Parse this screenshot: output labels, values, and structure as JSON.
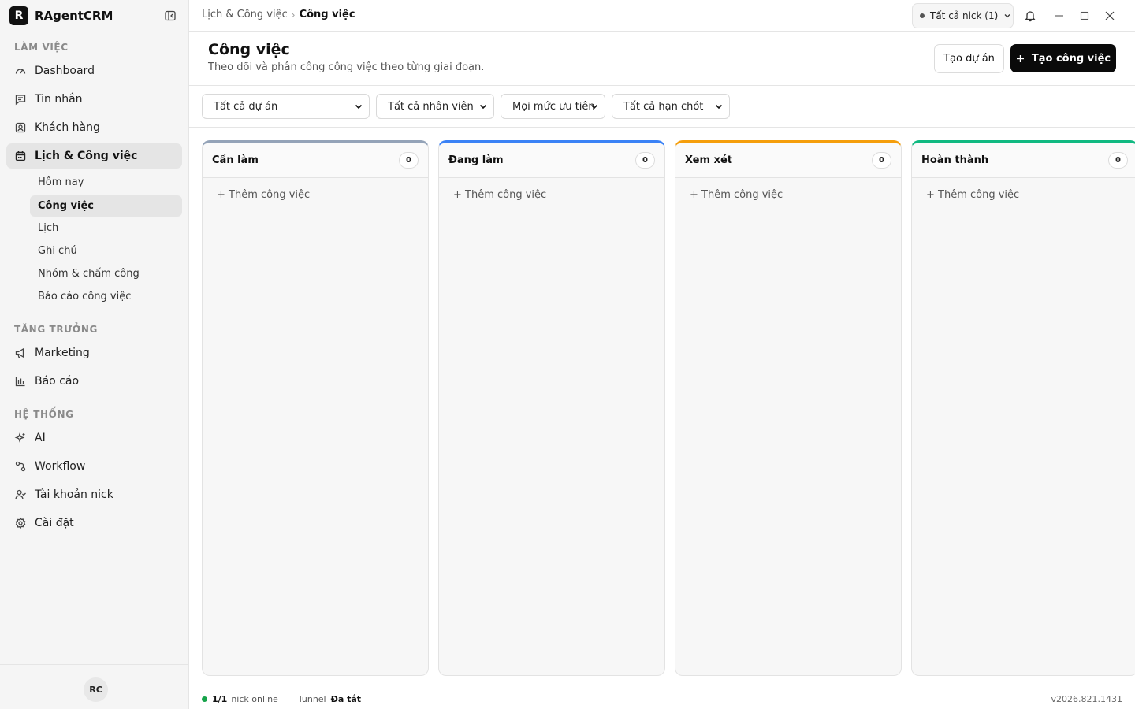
{
  "app": {
    "logo_letter": "R",
    "name": "RAgentCRM"
  },
  "sidebar": {
    "sections": {
      "work": "LÀM VIỆC",
      "growth": "TĂNG TRƯỞNG",
      "system": "HỆ THỐNG"
    },
    "items": {
      "dashboard": "Dashboard",
      "messages": "Tin nhắn",
      "customers": "Khách hàng",
      "schedule": "Lịch & Công việc",
      "marketing": "Marketing",
      "reports": "Báo cáo",
      "ai": "AI",
      "workflow": "Workflow",
      "accounts": "Tài khoản nick",
      "settings": "Cài đặt"
    },
    "sub_items": {
      "today": "Hôm nay",
      "tasks": "Công việc",
      "calendar": "Lịch",
      "notes": "Ghi chú",
      "teams": "Nhóm & chấm công",
      "task_reports": "Báo cáo công việc"
    },
    "active_item": "schedule",
    "active_sub_item": "tasks",
    "avatar_initials": "RC"
  },
  "topbar": {
    "breadcrumb_parent": "Lịch & Công việc",
    "breadcrumb_current": "Công việc",
    "nick_select": "Tất cả nick (1)"
  },
  "header": {
    "title": "Công việc",
    "subtitle": "Theo dõi và phân công công việc theo từng giai đoạn.",
    "create_project_label": "Tạo dự án",
    "create_task_label": "Tạo công việc"
  },
  "filters": {
    "project": "Tất cả dự án",
    "staff": "Tất cả nhân viên",
    "priority": "Mọi mức ưu tiên",
    "deadline": "Tất cả hạn chót"
  },
  "columns": [
    {
      "title": "Cần làm",
      "count": "0",
      "add_label": "+ Thêm công việc",
      "accent": "#94a3b8"
    },
    {
      "title": "Đang làm",
      "count": "0",
      "add_label": "+ Thêm công việc",
      "accent": "#3b82f6"
    },
    {
      "title": "Xem xét",
      "count": "0",
      "add_label": "+ Thêm công việc",
      "accent": "#f59e0b"
    },
    {
      "title": "Hoàn thành",
      "count": "0",
      "add_label": "+ Thêm công việc",
      "accent": "#10b981"
    }
  ],
  "status": {
    "online_count": "1/1",
    "online_label": "nick online",
    "tunnel_label": "Tunnel",
    "tunnel_value": "Đã tắt",
    "version": "v2026.821.1431",
    "online_color": "#16a34a"
  },
  "icons": {
    "collapse": "sidebar-collapse-icon",
    "dashboard": "gauge-icon",
    "messages": "message-square-icon",
    "customers": "contact-icon",
    "schedule": "calendar-icon",
    "marketing": "megaphone-icon",
    "reports": "bar-chart-icon",
    "ai": "sparkles-icon",
    "workflow": "workflow-icon",
    "accounts": "user-check-icon",
    "settings": "gear-icon",
    "bell": "bell-icon",
    "minimize": "minimize-icon",
    "maximize": "maximize-icon",
    "close": "close-icon"
  }
}
